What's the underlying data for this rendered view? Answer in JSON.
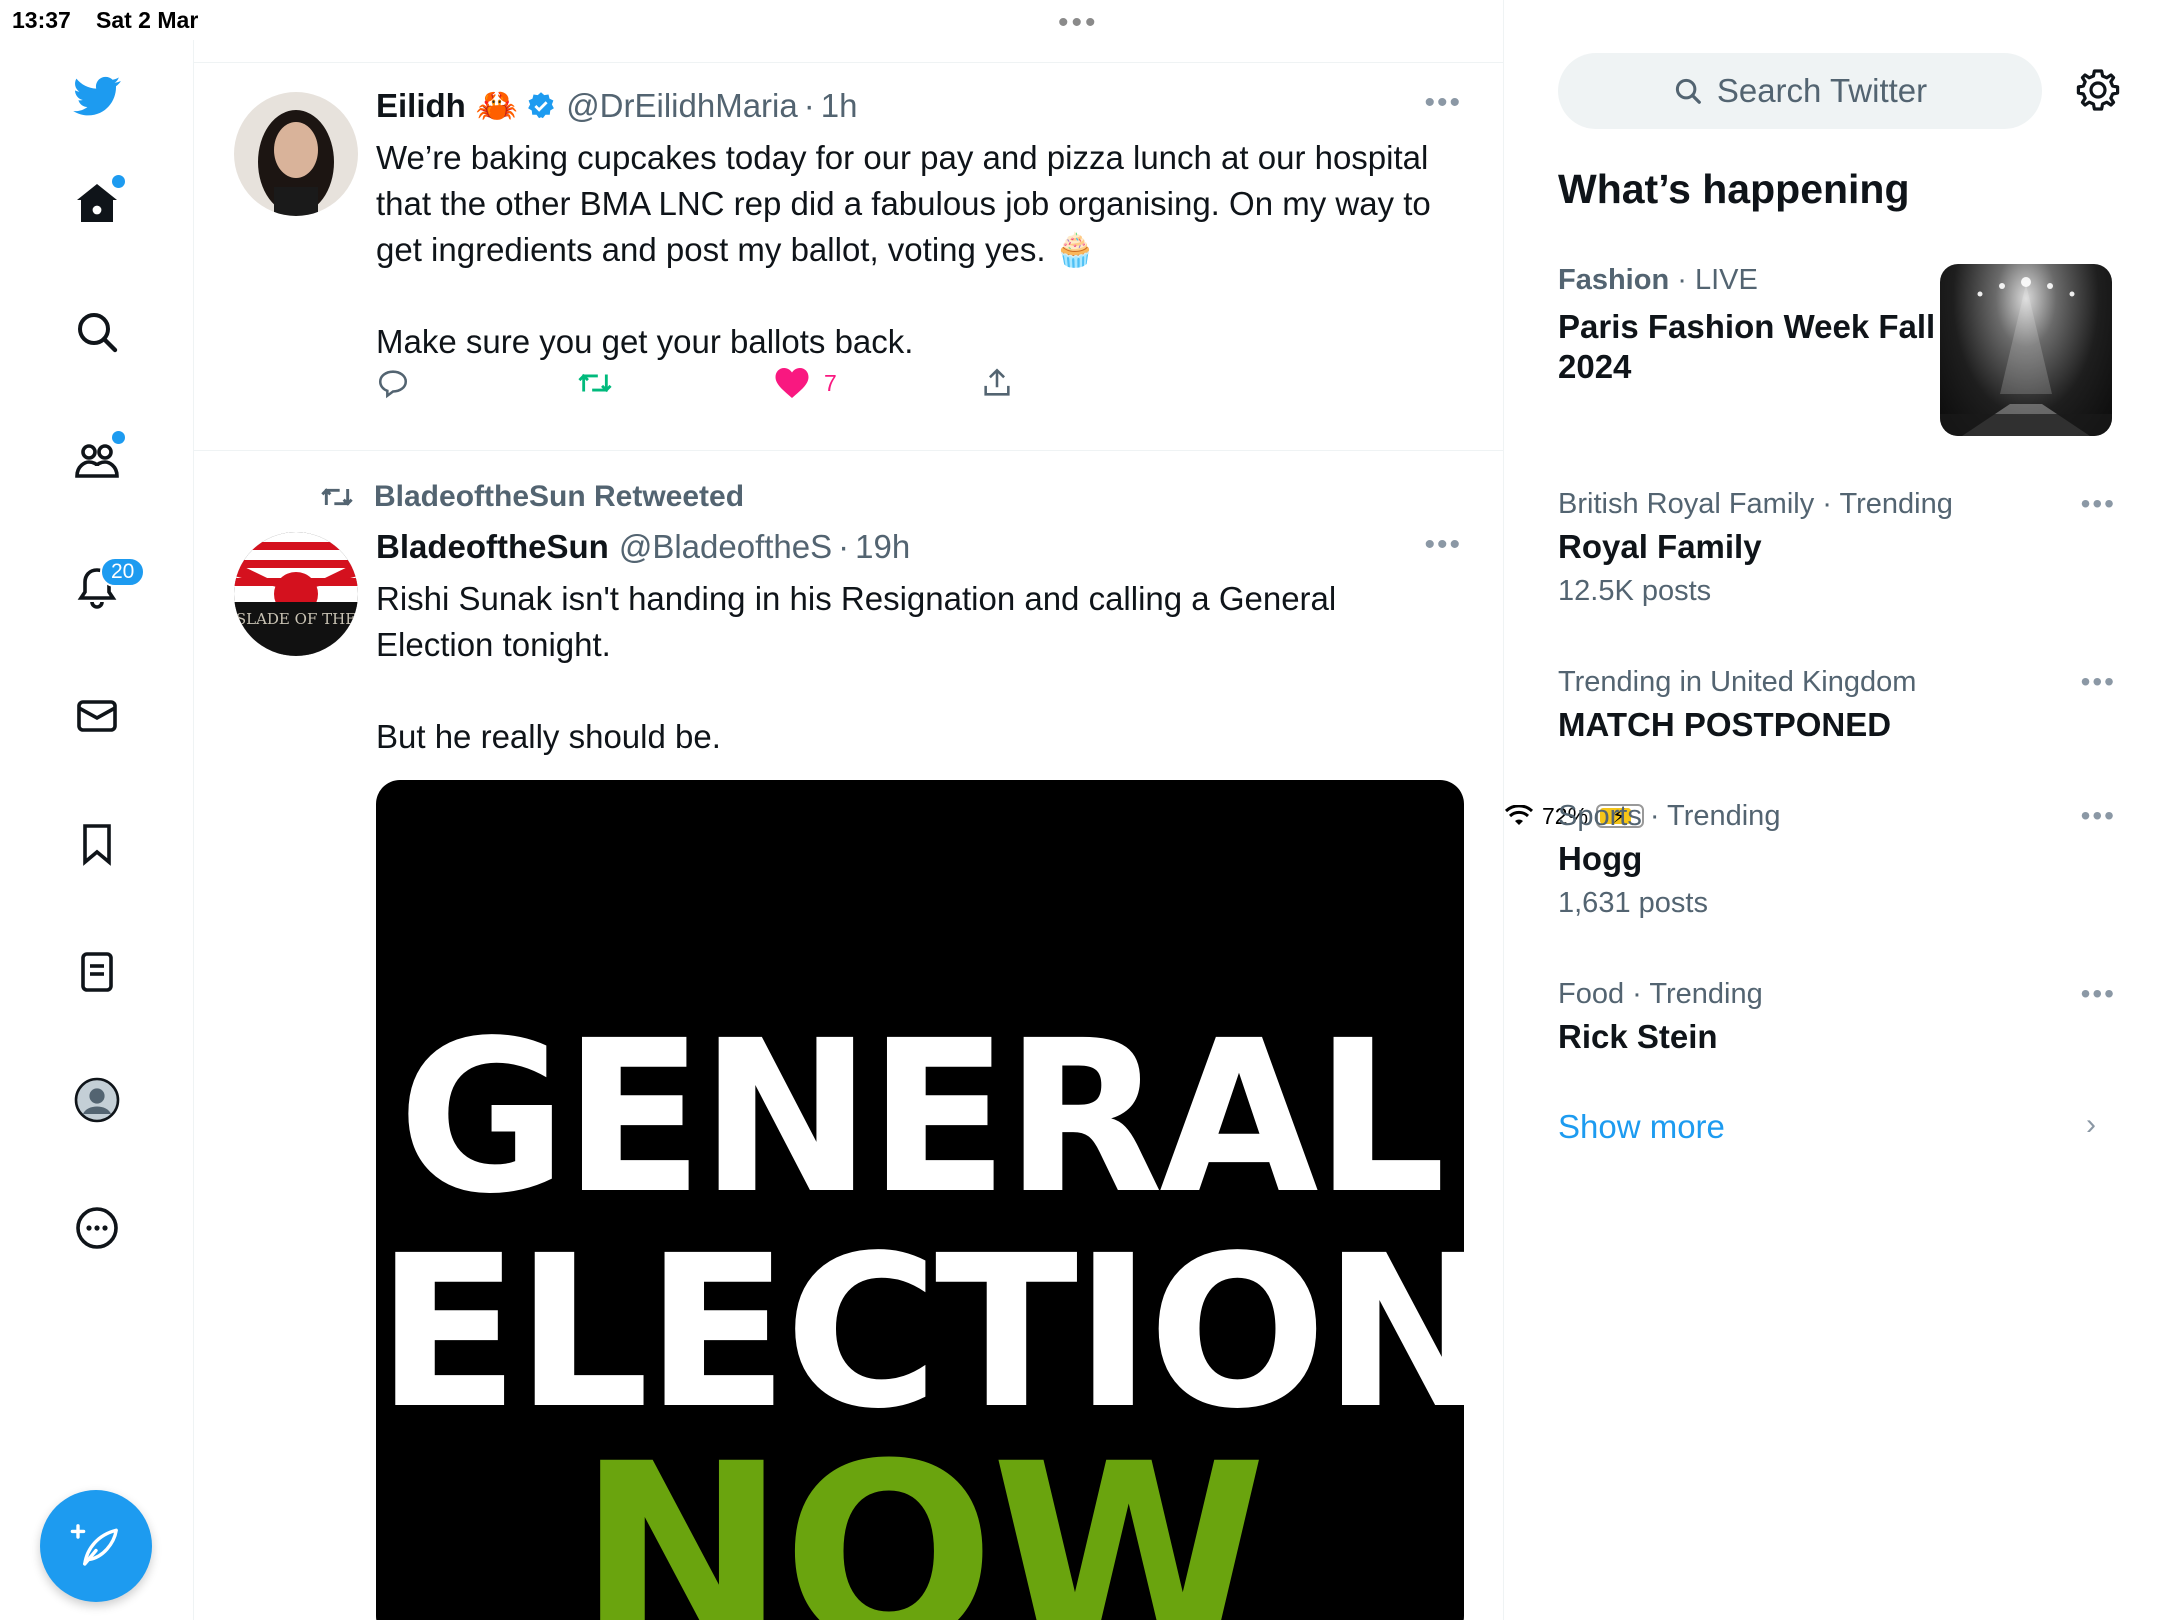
{
  "status_bar": {
    "time": "13:37",
    "date": "Sat 2 Mar",
    "battery": "72%"
  },
  "nav": {
    "notifications_count": "20"
  },
  "tweets": [
    {
      "name": "Eilidh",
      "emoji": "🦀",
      "handle": "@DrEilidhMaria",
      "time": "1h",
      "text": "We’re baking cupcakes today for our pay and pizza lunch at our hospital that the other BMA LNC rep did a fabulous job organising. On my way to get ingredients and post my ballot, voting yes. 🧁\n\nMake sure you get your ballots back.",
      "likes": "7"
    },
    {
      "retweeted_by": "BladeoftheSun Retweeted",
      "name": "BladeoftheSun",
      "handle": "@BladeoftheS",
      "time": "19h",
      "text": "Rishi Sunak isn't handing in his Resignation and calling a General Election tonight.\n\nBut he really should be.",
      "avatar_text": "SLADE OF THE",
      "media": {
        "line1": "GENERAL",
        "line2": "ELECTION",
        "line3": "NOW"
      }
    }
  ],
  "sidebar": {
    "search_placeholder": "Search Twitter",
    "title": "What’s happening",
    "trends": [
      {
        "category": "Fashion",
        "extra": "LIVE",
        "title": "Paris Fashion Week Fall 2024"
      },
      {
        "category": "British Royal Family · Trending",
        "title": "Royal Family",
        "count": "12.5K posts"
      },
      {
        "category": "Trending in United Kingdom",
        "title": "MATCH POSTPONED"
      },
      {
        "category": "Sports · Trending",
        "title": "Hogg",
        "count": "1,631 posts"
      },
      {
        "category": "Food · Trending",
        "title": "Rick Stein"
      }
    ],
    "show_more": "Show more"
  },
  "colors": {
    "accent": "#1d9bf0",
    "like": "#f91880",
    "retweet": "#00ba7c",
    "secondary_text": "#536471",
    "now_green": "#6aa40e"
  }
}
